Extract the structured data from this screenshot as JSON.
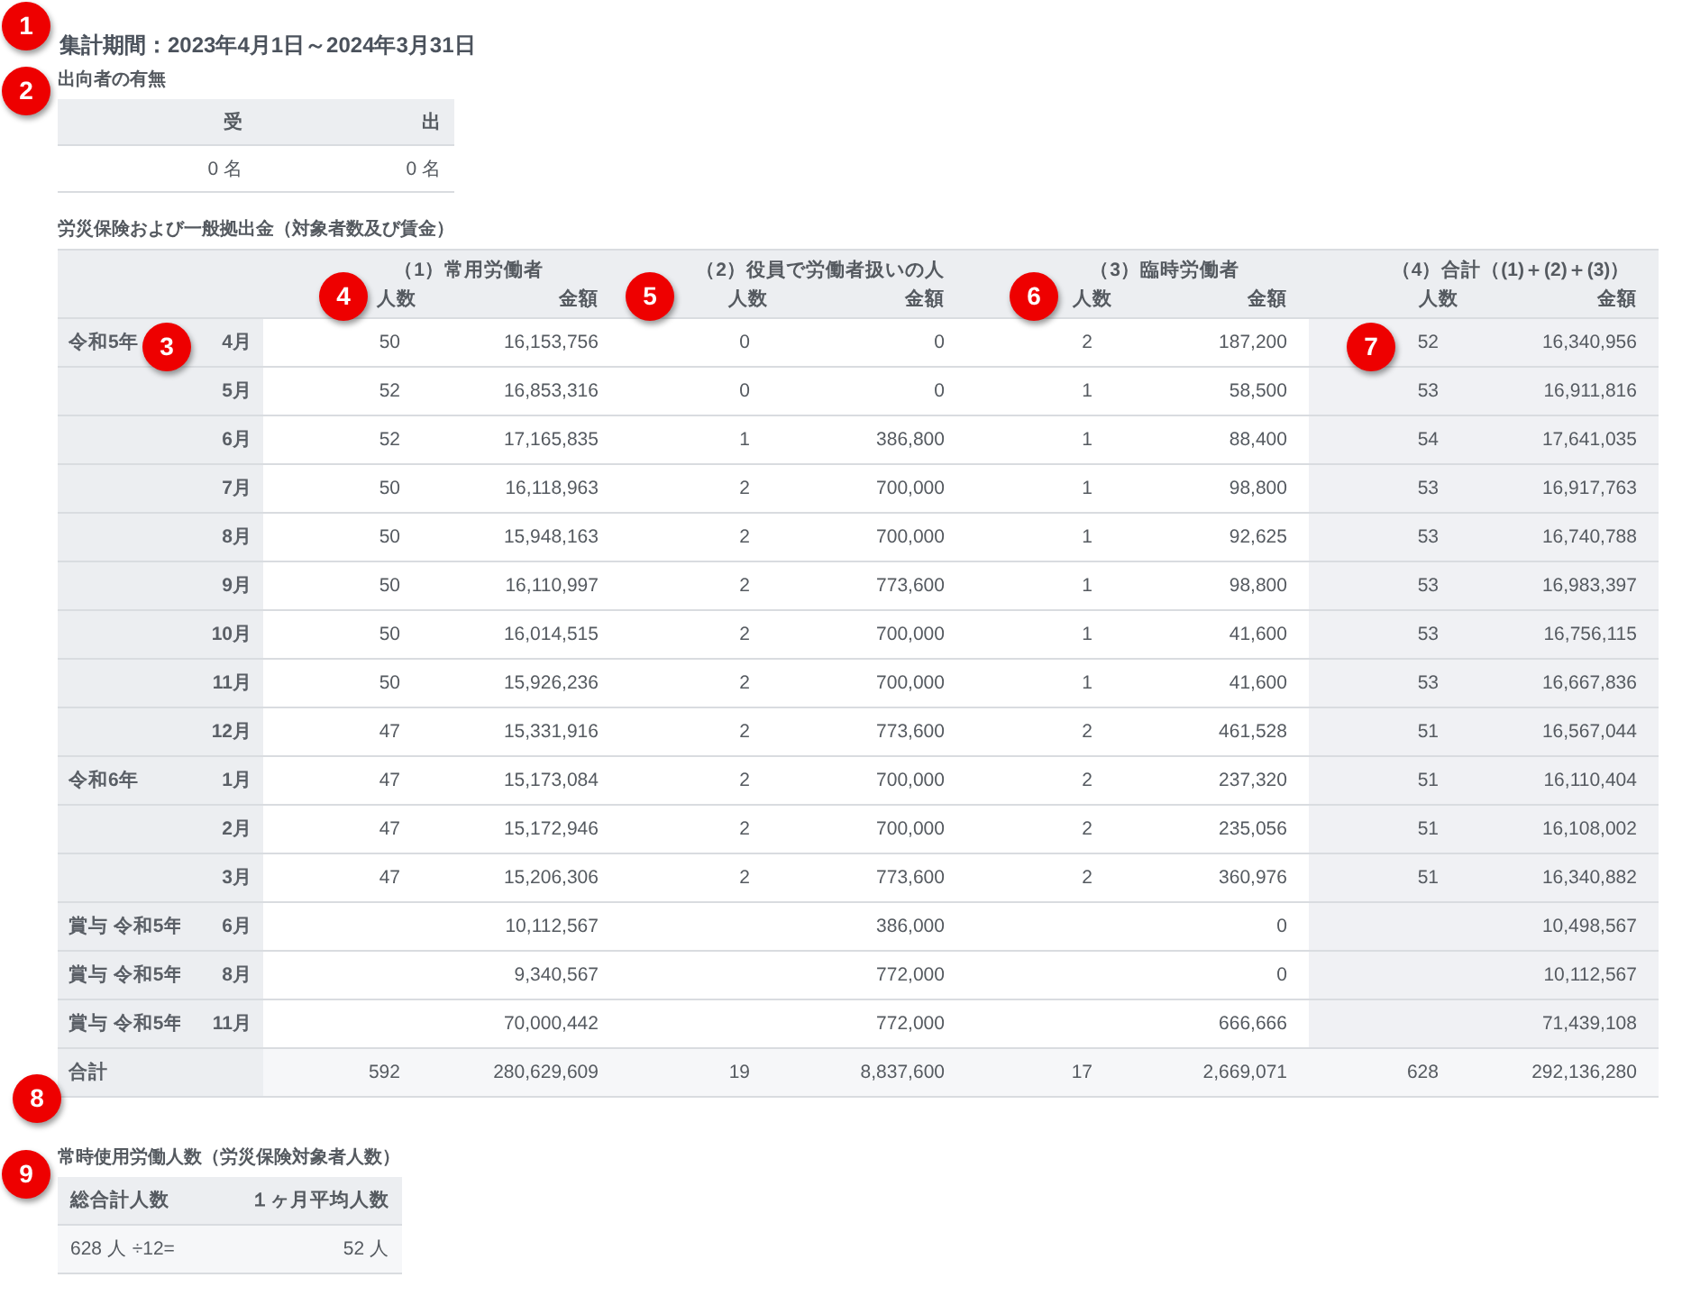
{
  "period_title": "集計期間：2023年4月1日～2024年3月31日",
  "secondment": {
    "heading": "出向者の有無",
    "columns": [
      "受",
      "出"
    ],
    "values": [
      "0 名",
      "0 名"
    ]
  },
  "insurance": {
    "heading": "労災保険および一般拠出金（対象者数及び賃金）",
    "groups": [
      {
        "title": "（1）常用労働者",
        "count_label": "人数",
        "amount_label": "金額",
        "highlight": false
      },
      {
        "title": "（2）役員で労働者扱いの人",
        "count_label": "人数",
        "amount_label": "金額",
        "highlight": false
      },
      {
        "title": "（3）臨時労働者",
        "count_label": "人数",
        "amount_label": "金額",
        "highlight": false
      },
      {
        "title": "（4）合計（(1)＋(2)＋(3)）",
        "count_label": "人数",
        "amount_label": "金額",
        "highlight": true
      }
    ],
    "rows": [
      {
        "label": "令和5年",
        "month": "4月",
        "cells": [
          {
            "count": "50",
            "amount": "16,153,756"
          },
          {
            "count": "0",
            "amount": "0"
          },
          {
            "count": "2",
            "amount": "187,200"
          },
          {
            "count": "52",
            "amount": "16,340,956"
          }
        ]
      },
      {
        "month": "5月",
        "cells": [
          {
            "count": "52",
            "amount": "16,853,316"
          },
          {
            "count": "0",
            "amount": "0"
          },
          {
            "count": "1",
            "amount": "58,500"
          },
          {
            "count": "53",
            "amount": "16,911,816"
          }
        ]
      },
      {
        "month": "6月",
        "cells": [
          {
            "count": "52",
            "amount": "17,165,835"
          },
          {
            "count": "1",
            "amount": "386,800"
          },
          {
            "count": "1",
            "amount": "88,400"
          },
          {
            "count": "54",
            "amount": "17,641,035"
          }
        ]
      },
      {
        "month": "7月",
        "cells": [
          {
            "count": "50",
            "amount": "16,118,963"
          },
          {
            "count": "2",
            "amount": "700,000"
          },
          {
            "count": "1",
            "amount": "98,800"
          },
          {
            "count": "53",
            "amount": "16,917,763"
          }
        ]
      },
      {
        "month": "8月",
        "cells": [
          {
            "count": "50",
            "amount": "15,948,163"
          },
          {
            "count": "2",
            "amount": "700,000"
          },
          {
            "count": "1",
            "amount": "92,625"
          },
          {
            "count": "53",
            "amount": "16,740,788"
          }
        ]
      },
      {
        "month": "9月",
        "cells": [
          {
            "count": "50",
            "amount": "16,110,997"
          },
          {
            "count": "2",
            "amount": "773,600"
          },
          {
            "count": "1",
            "amount": "98,800"
          },
          {
            "count": "53",
            "amount": "16,983,397"
          }
        ]
      },
      {
        "month": "10月",
        "cells": [
          {
            "count": "50",
            "amount": "16,014,515"
          },
          {
            "count": "2",
            "amount": "700,000"
          },
          {
            "count": "1",
            "amount": "41,600"
          },
          {
            "count": "53",
            "amount": "16,756,115"
          }
        ]
      },
      {
        "month": "11月",
        "cells": [
          {
            "count": "50",
            "amount": "15,926,236"
          },
          {
            "count": "2",
            "amount": "700,000"
          },
          {
            "count": "1",
            "amount": "41,600"
          },
          {
            "count": "53",
            "amount": "16,667,836"
          }
        ]
      },
      {
        "month": "12月",
        "cells": [
          {
            "count": "47",
            "amount": "15,331,916"
          },
          {
            "count": "2",
            "amount": "773,600"
          },
          {
            "count": "2",
            "amount": "461,528"
          },
          {
            "count": "51",
            "amount": "16,567,044"
          }
        ]
      },
      {
        "label": "令和6年",
        "month": "1月",
        "cells": [
          {
            "count": "47",
            "amount": "15,173,084"
          },
          {
            "count": "2",
            "amount": "700,000"
          },
          {
            "count": "2",
            "amount": "237,320"
          },
          {
            "count": "51",
            "amount": "16,110,404"
          }
        ]
      },
      {
        "month": "2月",
        "cells": [
          {
            "count": "47",
            "amount": "15,172,946"
          },
          {
            "count": "2",
            "amount": "700,000"
          },
          {
            "count": "2",
            "amount": "235,056"
          },
          {
            "count": "51",
            "amount": "16,108,002"
          }
        ]
      },
      {
        "month": "3月",
        "cells": [
          {
            "count": "47",
            "amount": "15,206,306"
          },
          {
            "count": "2",
            "amount": "773,600"
          },
          {
            "count": "2",
            "amount": "360,976"
          },
          {
            "count": "51",
            "amount": "16,340,882"
          }
        ]
      },
      {
        "label": "賞与 令和5年",
        "month": "6月",
        "cells": [
          {
            "amount": "10,112,567"
          },
          {
            "amount": "386,000"
          },
          {
            "amount": "0"
          },
          {
            "amount": "10,498,567"
          }
        ]
      },
      {
        "label": "賞与 令和5年",
        "month": "8月",
        "cells": [
          {
            "amount": "9,340,567"
          },
          {
            "amount": "772,000"
          },
          {
            "amount": "0"
          },
          {
            "amount": "10,112,567"
          }
        ]
      },
      {
        "label": "賞与 令和5年",
        "month": "11月",
        "cells": [
          {
            "amount": "70,000,442"
          },
          {
            "amount": "772,000"
          },
          {
            "amount": "666,666"
          },
          {
            "amount": "71,439,108"
          }
        ]
      }
    ],
    "total": {
      "label": "合計",
      "cells": [
        {
          "count": "592",
          "amount": "280,629,609"
        },
        {
          "count": "19",
          "amount": "8,837,600"
        },
        {
          "count": "17",
          "amount": "2,669,071"
        },
        {
          "count": "628",
          "amount": "292,136,280"
        }
      ]
    }
  },
  "regular_workers": {
    "heading": "常時使用労働人数（労災保険対象者人数）",
    "columns": [
      "総合計人数",
      "１ヶ月平均人数"
    ],
    "total": "628 人 ÷12=",
    "average": "52 人"
  },
  "markers": [
    "1",
    "2",
    "3",
    "4",
    "5",
    "6",
    "7",
    "8",
    "9"
  ]
}
